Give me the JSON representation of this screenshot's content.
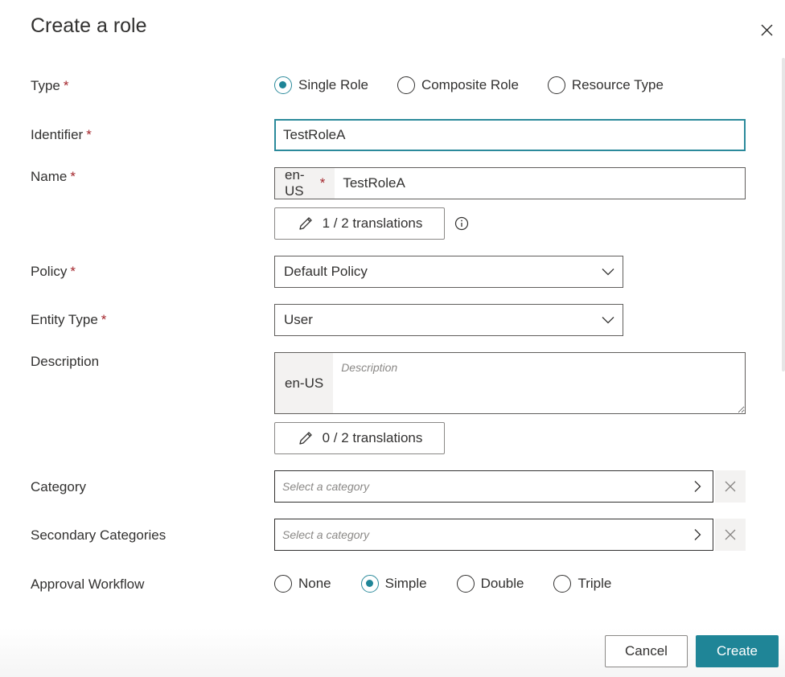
{
  "dialog": {
    "title": "Create a role",
    "close_icon": "close-icon"
  },
  "form": {
    "type": {
      "label": "Type",
      "required": "*",
      "options": [
        "Single Role",
        "Composite Role",
        "Resource Type"
      ],
      "selected": "Single Role"
    },
    "identifier": {
      "label": "Identifier",
      "required": "*",
      "value": "TestRoleA"
    },
    "name": {
      "label": "Name",
      "required": "*",
      "locale": "en-US",
      "locale_required": "*",
      "value": "TestRoleA",
      "translations_label": "1 / 2 translations",
      "info_icon": "info-icon"
    },
    "policy": {
      "label": "Policy",
      "required": "*",
      "value": "Default Policy"
    },
    "entity_type": {
      "label": "Entity Type",
      "required": "*",
      "value": "User"
    },
    "description": {
      "label": "Description",
      "locale": "en-US",
      "placeholder": "Description",
      "translations_label": "0 / 2 translations"
    },
    "category": {
      "label": "Category",
      "placeholder": "Select a category"
    },
    "secondary_categories": {
      "label": "Secondary Categories",
      "placeholder": "Select a category"
    },
    "approval_workflow": {
      "label": "Approval Workflow",
      "options": [
        "None",
        "Simple",
        "Double",
        "Triple"
      ],
      "selected": "Simple"
    }
  },
  "footer": {
    "cancel_label": "Cancel",
    "create_label": "Create"
  },
  "colors": {
    "accent": "#1f8597",
    "required": "#a4262c"
  }
}
